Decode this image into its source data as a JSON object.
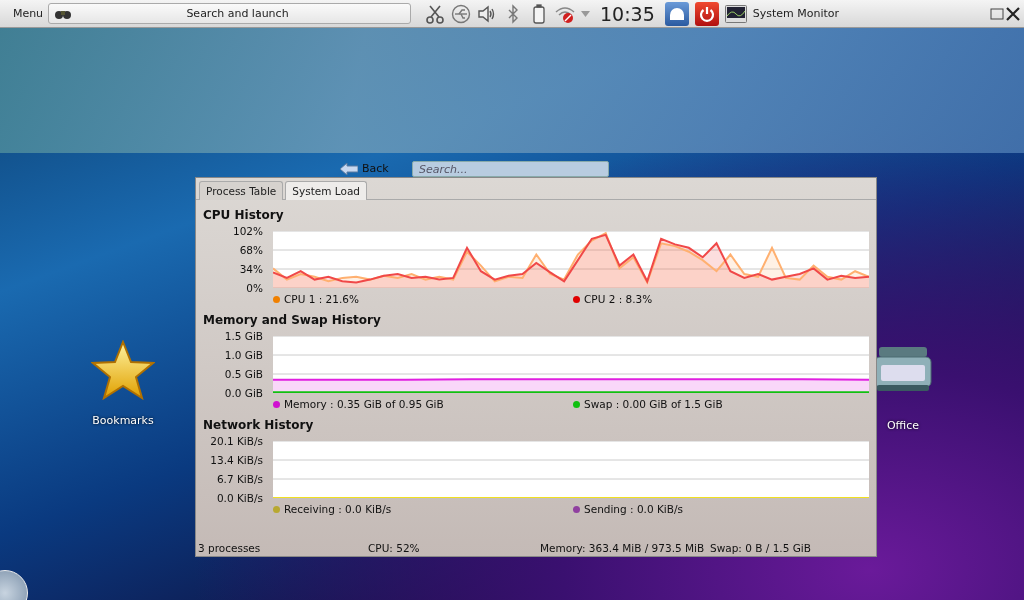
{
  "panel": {
    "menu": "Menu",
    "launcher": "Search and launch",
    "clock": "10:35",
    "task": "System Monitor"
  },
  "launcher_nav": {
    "back": "Back",
    "search": {
      "placeholder": "Search..."
    }
  },
  "desktop_icons": [
    {
      "label": "Bookmarks",
      "kind": "star"
    },
    {
      "label": "Office",
      "kind": "typewriter"
    }
  ],
  "window": {
    "tabs": [
      {
        "label": "Process Table",
        "selected": false
      },
      {
        "label": "System Load",
        "selected": true
      }
    ],
    "sections": [
      {
        "title": "CPU History",
        "legend": [
          {
            "text": "CPU 1 : 21.6%",
            "color": "#f08000"
          },
          {
            "text": "CPU 2 : 8.3%",
            "color": "#e00000"
          }
        ],
        "chart_data": {
          "type": "area",
          "ylim": [
            0,
            102
          ],
          "yticks": [
            {
              "value": 102,
              "label": "102%"
            },
            {
              "value": 68,
              "label": "68%"
            },
            {
              "value": 34,
              "label": "34%"
            },
            {
              "value": 0,
              "label": "0%"
            }
          ],
          "series": [
            {
              "color": "#ffb070",
              "values": [
                35,
                15,
                25,
                20,
                12,
                18,
                20,
                15,
                22,
                18,
                25,
                15,
                20,
                15,
                65,
                40,
                12,
                20,
                18,
                60,
                25,
                15,
                60,
                85,
                98,
                35,
                55,
                10,
                80,
                75,
                65,
                50,
                30,
                60,
                25,
                20,
                72,
                18,
                15,
                40,
                20,
                15,
                30,
                20
              ]
            },
            {
              "color": "#f04848",
              "values": [
                28,
                18,
                30,
                15,
                20,
                12,
                10,
                15,
                22,
                25,
                18,
                20,
                15,
                18,
                72,
                30,
                15,
                22,
                25,
                45,
                28,
                12,
                50,
                88,
                95,
                40,
                60,
                12,
                88,
                78,
                72,
                55,
                80,
                30,
                18,
                25,
                15,
                20,
                25,
                35,
                15,
                22,
                18,
                20
              ]
            }
          ]
        }
      },
      {
        "title": "Memory and Swap History",
        "legend": [
          {
            "text": "Memory : 0.35 GiB of 0.95 GiB",
            "color": "#d010d0"
          },
          {
            "text": "Swap : 0.00 GiB of 1.5 GiB",
            "color": "#10c010"
          }
        ],
        "chart_data": {
          "type": "area",
          "ylim": [
            0,
            1.5
          ],
          "yticks": [
            {
              "value": 1.5,
              "label": "1.5 GiB"
            },
            {
              "value": 1.0,
              "label": "1.0 GiB"
            },
            {
              "value": 0.5,
              "label": "0.5 GiB"
            },
            {
              "value": 0,
              "label": "0.0 GiB"
            }
          ],
          "series": [
            {
              "color": "#e020e0",
              "values": [
                0.35,
                0.35,
                0.35,
                0.36,
                0.36,
                0.36,
                0.36,
                0.36,
                0.36,
                0.35
              ]
            },
            {
              "color": "#10c010",
              "values": [
                0.02,
                0.02,
                0.02,
                0.02,
                0.02,
                0.02,
                0.02,
                0.02,
                0.02,
                0.02
              ]
            }
          ]
        }
      },
      {
        "title": "Network History",
        "legend": [
          {
            "text": "Receiving : 0.0 KiB/s",
            "color": "#b8a830"
          },
          {
            "text": "Sending : 0.0 KiB/s",
            "color": "#9040a0"
          }
        ],
        "chart_data": {
          "type": "line",
          "ylim": [
            0,
            20.1
          ],
          "yticks": [
            {
              "value": 20.1,
              "label": "20.1 KiB/s"
            },
            {
              "value": 13.4,
              "label": "13.4 KiB/s"
            },
            {
              "value": 6.7,
              "label": "6.7 KiB/s"
            },
            {
              "value": 0,
              "label": "0.0 KiB/s"
            }
          ],
          "series": [
            {
              "color": "#f0e020",
              "values": [
                0,
                0,
                0,
                0,
                0
              ]
            }
          ]
        }
      }
    ],
    "status_bar": [
      "3 processes",
      "CPU: 52%",
      "Memory: 363.4 MiB / 973.5 MiB",
      "Swap: 0 B / 1.5 GiB"
    ]
  }
}
